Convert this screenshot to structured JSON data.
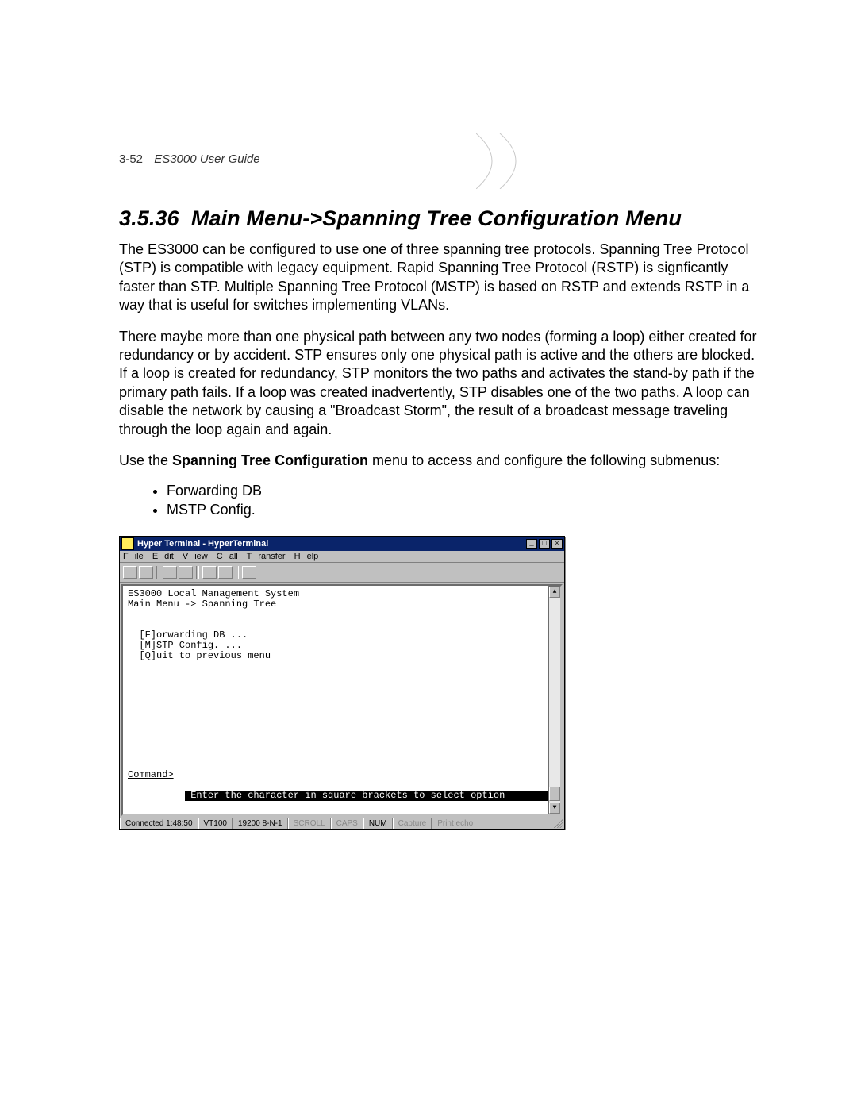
{
  "header": {
    "page_number": "3-52",
    "book_title": "ES3000 User Guide"
  },
  "section": {
    "number": "3.5.36",
    "title": "Main Menu->Spanning Tree Configuration Menu"
  },
  "paragraphs": {
    "p1": "The ES3000 can be configured to use one of three spanning tree protocols. Spanning Tree Protocol (STP) is compatible with legacy equipment. Rapid Spanning Tree Protocol (RSTP) is signficantly faster than STP. Multiple Spanning Tree Protocol (MSTP) is based on RSTP and extends RSTP in a way that is useful for switches implementing VLANs.",
    "p2": "There maybe more than one physical path between any two nodes (forming a loop) either created for redundancy or by accident. STP ensures only one physical path is active and the others are blocked. If a loop is created for redundancy, STP monitors the two paths and activates the stand-by path if the primary path fails. If a loop was created inadvertently, STP disables one of the two paths. A loop can disable the network by causing a \"Broadcast Storm\", the result of a broadcast message traveling through the loop again and again.",
    "p3_prefix": "Use the ",
    "p3_bold": "Spanning Tree Configuration",
    "p3_suffix": " menu to access and configure the following submenus:"
  },
  "bullets": {
    "b1": "Forwarding DB",
    "b2": "MSTP Config."
  },
  "hyperterminal": {
    "window_title": "Hyper Terminal - HyperTerminal",
    "menus": {
      "file": "File",
      "edit": "Edit",
      "view": "View",
      "call": "Call",
      "transfer": "Transfer",
      "help": "Help"
    },
    "terminal_text": "ES3000 Local Management System\nMain Menu -> Spanning Tree\n\n\n  [F]orwarding DB ...\n  [M]STP Config. ...\n  [Q]uit to previous menu",
    "prompt": "Command>",
    "instruction": " Enter the character in square brackets to select option                 ",
    "status": {
      "connected": "Connected 1:48:50",
      "emulation": "VT100",
      "settings": "19200 8-N-1",
      "scroll": "SCROLL",
      "caps": "CAPS",
      "num": "NUM",
      "capture": "Capture",
      "printecho": "Print echo"
    },
    "winctl": {
      "min": "_",
      "max": "□",
      "close": "×"
    }
  }
}
